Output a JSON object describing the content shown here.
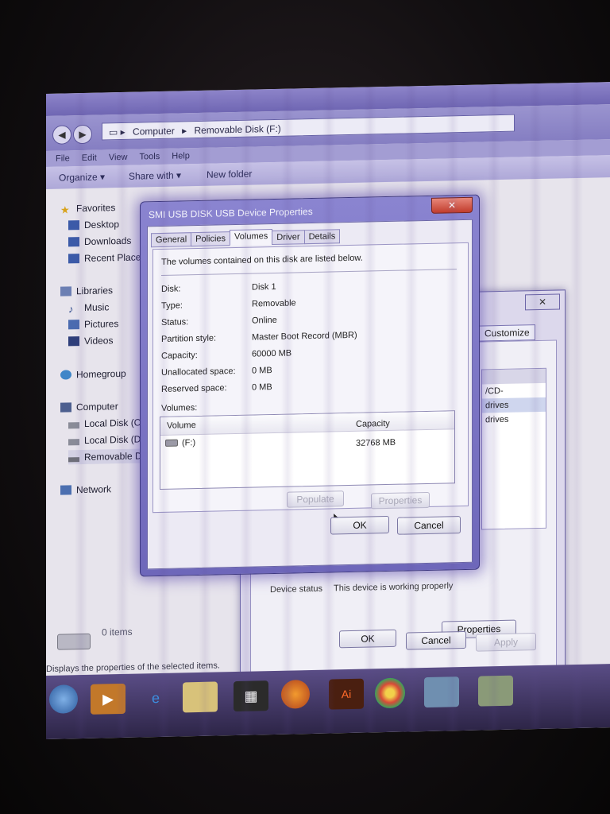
{
  "explorer": {
    "breadcrumb": [
      "Computer",
      "Removable Disk (F:)"
    ],
    "menu": [
      "File",
      "Edit",
      "View",
      "Tools",
      "Help"
    ],
    "toolbar": {
      "organize": "Organize ▾",
      "share_with": "Share with ▾",
      "new_folder": "New folder"
    },
    "nav": {
      "favorites": "Favorites",
      "desktop": "Desktop",
      "downloads": "Downloads",
      "recent_places": "Recent Places",
      "libraries": "Libraries",
      "music": "Music",
      "pictures": "Pictures",
      "videos": "Videos",
      "homegroup": "Homegroup",
      "computer": "Computer",
      "local_disk_c": "Local Disk (C:)",
      "local_disk_d": "Local Disk (D:)",
      "removable_disk": "Removable Di",
      "network": "Network"
    },
    "item_count": "0 items",
    "status_text": "Displays the properties of the selected items."
  },
  "background_dialog": {
    "tab_customize": "Customize",
    "list_items": [
      "",
      "/CD-",
      "drives",
      "drives"
    ],
    "device_status_label": "Device status",
    "device_status_value": "This device is working properly",
    "properties_button": "Properties",
    "ok_button": "OK",
    "cancel_button": "Cancel",
    "apply_button": "Apply"
  },
  "dialog": {
    "title": "SMI USB DISK USB Device Properties",
    "close_glyph": "✕",
    "tabs": [
      "General",
      "Policies",
      "Volumes",
      "Driver",
      "Details"
    ],
    "active_tab": "Volumes",
    "intro": "The volumes contained on this disk are listed below.",
    "fields": {
      "disk_label": "Disk:",
      "disk_value": "Disk 1",
      "type_label": "Type:",
      "type_value": "Removable",
      "status_label": "Status:",
      "status_value": "Online",
      "partition_label": "Partition style:",
      "partition_value": "Master Boot Record (MBR)",
      "capacity_label": "Capacity:",
      "capacity_value": "60000 MB",
      "unallocated_label": "Unallocated space:",
      "unallocated_value": "0 MB",
      "reserved_label": "Reserved space:",
      "reserved_value": "0 MB"
    },
    "volumes_label": "Volumes:",
    "volume_table": {
      "col_volume": "Volume",
      "col_capacity": "Capacity",
      "row_volume": "(F:)",
      "row_capacity": "32768 MB"
    },
    "populate_button": "Populate",
    "properties_button": "Properties",
    "ok_button": "OK",
    "cancel_button": "Cancel"
  }
}
